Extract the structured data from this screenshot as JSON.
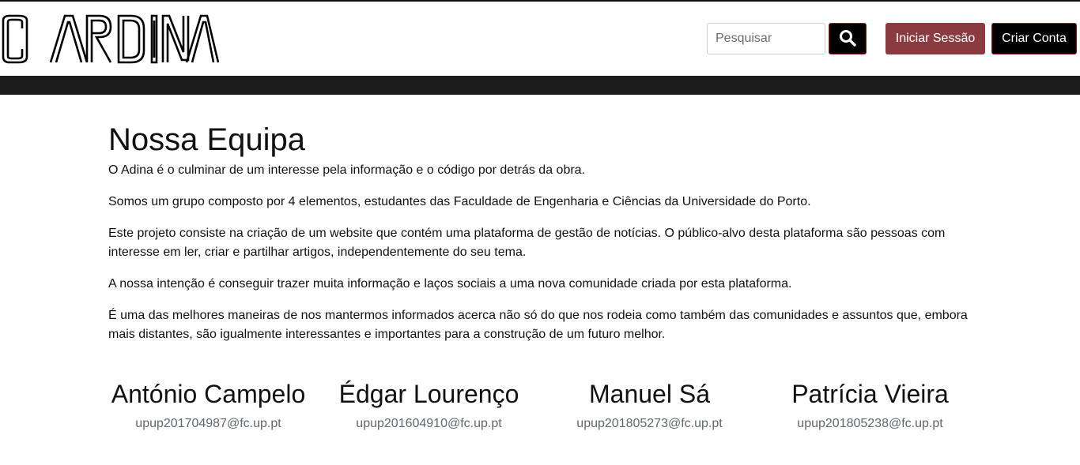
{
  "header": {
    "logo_text": "O ARDINA",
    "search": {
      "placeholder": "Pesquisar",
      "value": ""
    },
    "search_icon": "search-icon",
    "login_label": "Iniciar Sessão",
    "signup_label": "Criar Conta"
  },
  "colors": {
    "login_button": "#8a3b40",
    "signup_button": "#000000",
    "navbar": "#1b1b1b",
    "email_text": "#5f666d"
  },
  "main": {
    "title": "Nossa Equipa",
    "paragraphs": [
      "O Adina é o culminar de um interesse pela informação e o código por detrás da obra.",
      "Somos um grupo composto por 4 elementos, estudantes das Faculdade de Engenharia e Ciências da Universidade do Porto.",
      "Este projeto consiste na criação de um website que contém uma plataforma de gestão de notícias. O público-alvo desta plataforma são pessoas com interesse em ler, criar e partilhar artigos, independentemente do seu tema.",
      "A nossa intenção é conseguir trazer muita informação e laços sociais a uma nova comunidade criada por esta plataforma.",
      "É uma das melhores maneiras de nos mantermos informados acerca não só do que nos rodeia como também das comunidades e assuntos que, embora mais distantes, são igualmente interessantes e importantes para a construção de um futuro melhor."
    ]
  },
  "team": [
    {
      "name": "António Campelo",
      "email": "upup201704987@fc.up.pt"
    },
    {
      "name": "Édgar Lourenço",
      "email": "upup201604910@fc.up.pt"
    },
    {
      "name": "Manuel Sá",
      "email": "upup201805273@fc.up.pt"
    },
    {
      "name": "Patrícia Vieira",
      "email": "upup201805238@fc.up.pt"
    }
  ]
}
